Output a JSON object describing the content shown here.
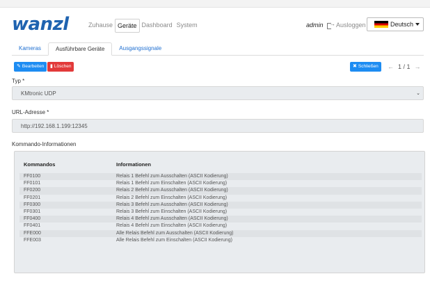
{
  "header": {
    "logo": "wanzl",
    "nav": [
      "Zuhause",
      "Geräte",
      "Dashboard",
      "System"
    ],
    "user": "admin",
    "logout": "Ausloggen",
    "language": "Deutsch"
  },
  "tabs": [
    "Kameras",
    "Ausführbare Geräte",
    "Ausgangssignale"
  ],
  "toolbar": {
    "edit": "Bearbeiten",
    "delete": "Löschen",
    "close": "Schließen",
    "page": "1 / 1"
  },
  "form": {
    "type_label": "Typ *",
    "type_value": "KMtronic UDP",
    "url_label": "URL-Adresse *",
    "url_value": "http://192.168.1.199:12345",
    "commands_label": "Kommando-Informationen"
  },
  "commands": {
    "headers": [
      "Kommandos",
      "Informationen"
    ],
    "rows": [
      [
        "FF0100",
        "Relais 1 Befehl zum Ausschalten (ASCII Kodierung)"
      ],
      [
        "FF0101",
        "Relais 1 Befehl zum Einschalten (ASCII Kodierung)"
      ],
      [
        "FF0200",
        "Relais 2 Befehl zum Ausschalten (ASCII Kodierung)"
      ],
      [
        "FF0201",
        "Relais 2 Befehl zum Einschalten (ASCII Kodierung)"
      ],
      [
        "FF0300",
        "Relais 3 Befehl zum Ausschalten (ASCII Kodierung)"
      ],
      [
        "FF0301",
        "Relais 3 Befehl zum Einschalten (ASCII Kodierung)"
      ],
      [
        "FF0400",
        "Relais 4 Befehl zum Ausschalten (ASCII Kodierung)"
      ],
      [
        "FF0401",
        "Relais 4 Befehl zum Einschalten (ASCII Kodierung)"
      ],
      [
        "FFE000",
        "Alle Relais Befehl zum Ausschalten (ASCII Kodierung)"
      ],
      [
        "FFE003",
        "Alle Relais Befehl zum Einschalten (ASCII Kodierung)"
      ]
    ]
  }
}
